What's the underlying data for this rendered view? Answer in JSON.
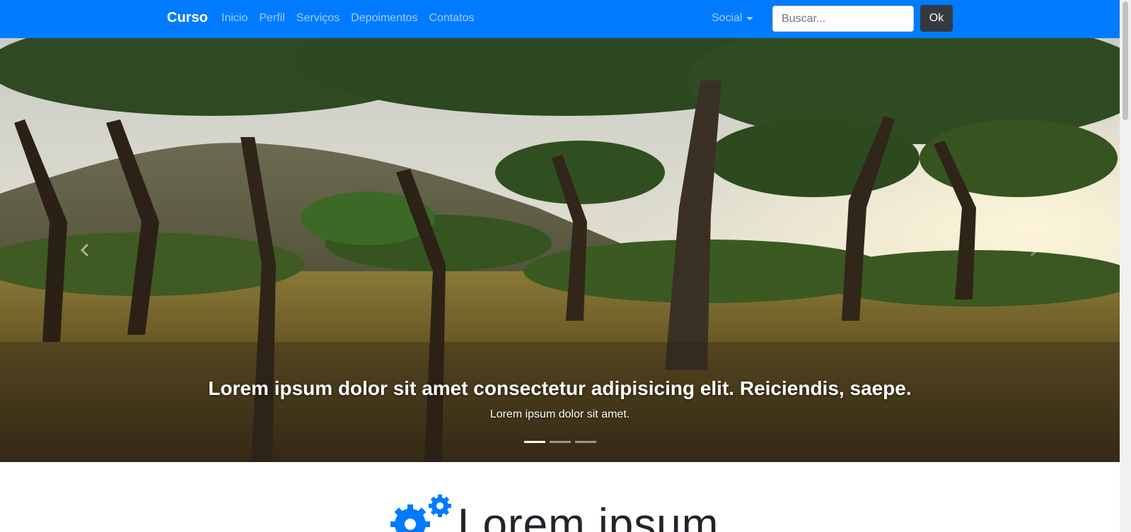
{
  "navbar": {
    "brand": "Curso",
    "links": [
      "Inicio",
      "Perfil",
      "Serviços",
      "Depoimentos",
      "Contatos"
    ],
    "dropdown_label": "Social",
    "search_placeholder": "Buscar...",
    "submit_label": "Ok",
    "bg_color": "#007bff"
  },
  "carousel": {
    "caption_title": "Lorem ipsum dolor sit amet consectetur adipisicing elit. Reiciendis, saepe.",
    "caption_text": "Lorem ipsum dolor sit amet.",
    "slide_count": 3,
    "active_slide": 1
  },
  "section": {
    "icon": "gears-icon",
    "title": "Lorem ipsum",
    "icon_color": "#007bff"
  }
}
